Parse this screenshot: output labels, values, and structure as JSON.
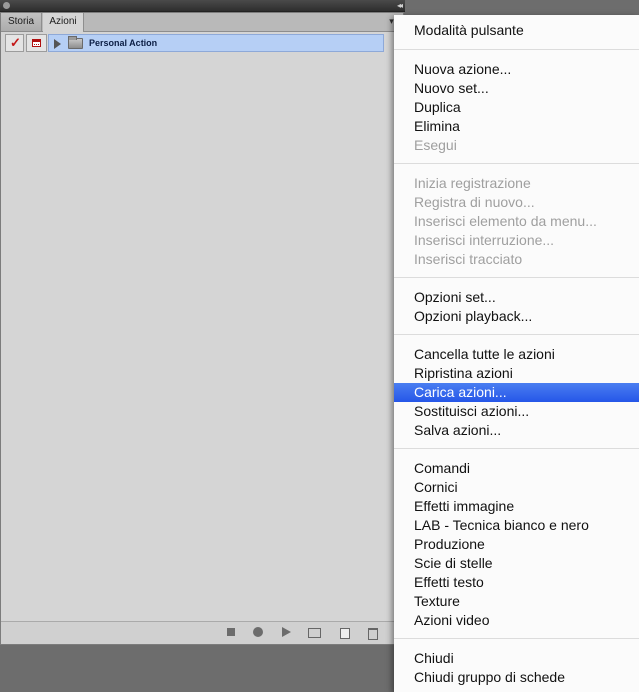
{
  "panel": {
    "tabs": [
      {
        "label": "Storia",
        "active": false
      },
      {
        "label": "Azioni",
        "active": true
      }
    ],
    "collapse_icon": "double-chevron-right-icon",
    "menu_icon": "panel-menu-icon",
    "actions": [
      {
        "name": "Personal Action",
        "checked": true,
        "dialog": true,
        "type": "folder-set"
      }
    ],
    "bottom_icons": [
      "stop-icon",
      "record-icon",
      "play-icon",
      "new-set-icon",
      "new-action-icon",
      "trash-icon"
    ]
  },
  "menu": {
    "groups": [
      [
        {
          "label": "Modalità pulsante",
          "enabled": true
        }
      ],
      [
        {
          "label": "Nuova azione...",
          "enabled": true
        },
        {
          "label": "Nuovo set...",
          "enabled": true
        },
        {
          "label": "Duplica",
          "enabled": true
        },
        {
          "label": "Elimina",
          "enabled": true
        },
        {
          "label": "Esegui",
          "enabled": false
        }
      ],
      [
        {
          "label": "Inizia registrazione",
          "enabled": false
        },
        {
          "label": "Registra di nuovo...",
          "enabled": false
        },
        {
          "label": "Inserisci elemento da menu...",
          "enabled": false
        },
        {
          "label": "Inserisci interruzione...",
          "enabled": false
        },
        {
          "label": "Inserisci tracciato",
          "enabled": false
        }
      ],
      [
        {
          "label": "Opzioni set...",
          "enabled": true
        },
        {
          "label": "Opzioni playback...",
          "enabled": true
        }
      ],
      [
        {
          "label": "Cancella tutte le azioni",
          "enabled": true
        },
        {
          "label": "Ripristina azioni",
          "enabled": true
        },
        {
          "label": "Carica azioni...",
          "enabled": true,
          "highlighted": true
        },
        {
          "label": "Sostituisci azioni...",
          "enabled": true
        },
        {
          "label": "Salva azioni...",
          "enabled": true
        }
      ],
      [
        {
          "label": "Comandi",
          "enabled": true
        },
        {
          "label": "Cornici",
          "enabled": true
        },
        {
          "label": "Effetti immagine",
          "enabled": true
        },
        {
          "label": "LAB - Tecnica bianco e nero",
          "enabled": true
        },
        {
          "label": "Produzione",
          "enabled": true
        },
        {
          "label": "Scie di stelle",
          "enabled": true
        },
        {
          "label": "Effetti testo",
          "enabled": true
        },
        {
          "label": "Texture",
          "enabled": true
        },
        {
          "label": "Azioni video",
          "enabled": true
        }
      ],
      [
        {
          "label": "Chiudi",
          "enabled": true
        },
        {
          "label": "Chiudi gruppo di schede",
          "enabled": true
        }
      ]
    ]
  }
}
